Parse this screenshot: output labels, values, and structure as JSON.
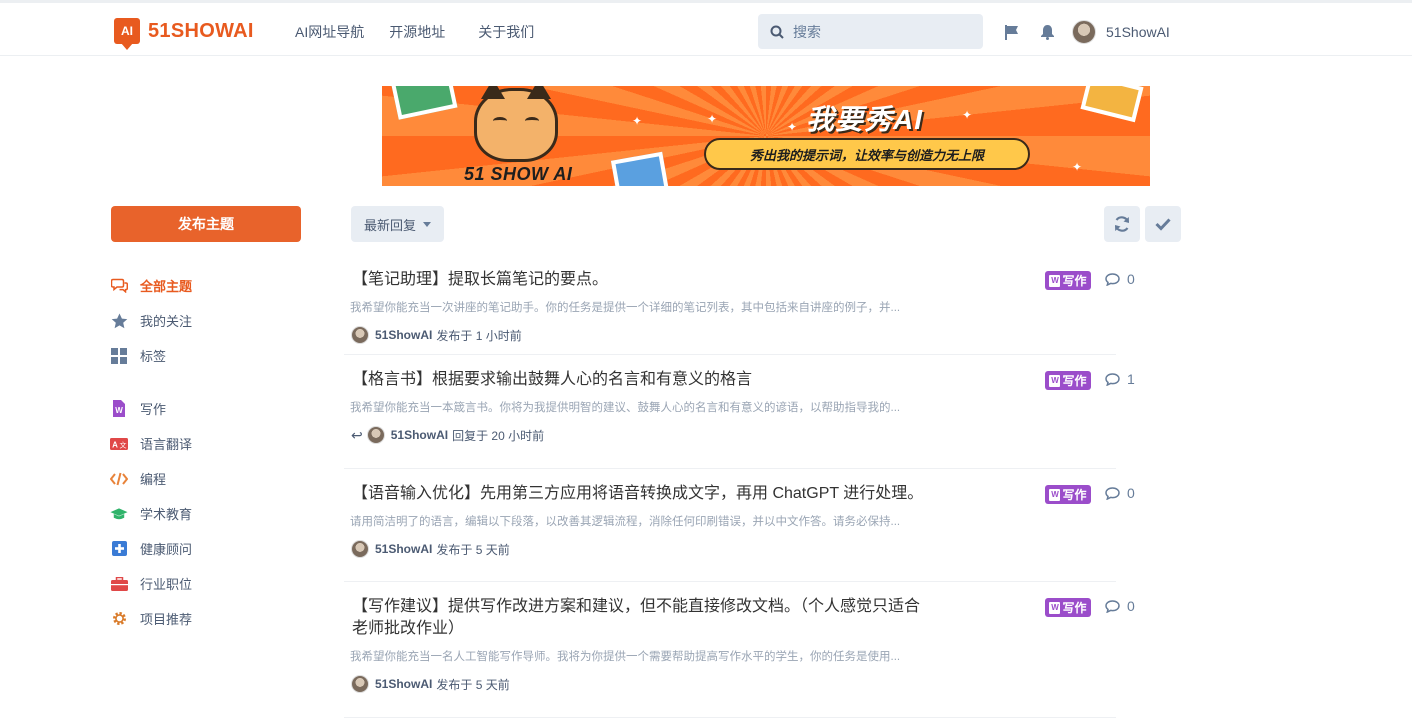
{
  "header": {
    "logo_mark": "AI",
    "logo_text": "51SHOWAI",
    "nav": [
      "AI网址导航",
      "开源地址",
      "关于我们"
    ],
    "search_placeholder": "搜索",
    "username": "51ShowAI"
  },
  "banner": {
    "brand": "51 SHOW AI",
    "headline": "我要秀AI",
    "tagline": "秀出我的提示词，让效率与创造力无上限"
  },
  "sidebar": {
    "new_discussion": "发布主题",
    "items": [
      {
        "label": "全部主题",
        "icon": "comments-icon",
        "active": true
      },
      {
        "label": "我的关注",
        "icon": "star-icon",
        "active": false
      },
      {
        "label": "标签",
        "icon": "grid-icon",
        "active": false
      }
    ],
    "tags": [
      {
        "label": "写作",
        "icon": "word-doc-icon",
        "color": "#9b4dca"
      },
      {
        "label": "语言翻译",
        "icon": "translate-icon",
        "color": "#e04848"
      },
      {
        "label": "编程",
        "icon": "code-icon",
        "color": "#e8833a"
      },
      {
        "label": "学术教育",
        "icon": "graduation-cap-icon",
        "color": "#2fb36a"
      },
      {
        "label": "健康顾问",
        "icon": "medical-plus-icon",
        "color": "#3a7bd5"
      },
      {
        "label": "行业职位",
        "icon": "briefcase-icon",
        "color": "#e04848"
      },
      {
        "label": "项目推荐",
        "icon": "gear-icon",
        "color": "#d97b2a"
      }
    ]
  },
  "toolbar": {
    "sort_label": "最新回复"
  },
  "discussions": [
    {
      "title": "【笔记助理】提取长篇笔记的要点。",
      "excerpt": "我希望你能充当一次讲座的笔记助手。你的任务是提供一个详细的笔记列表，其中包括来自讲座的例子，并...",
      "user": "51ShowAI",
      "action": "发布于 1 小时前",
      "replied": false,
      "tag": "写作",
      "count": "0"
    },
    {
      "title": "【格言书】根据要求输出鼓舞人心的名言和有意义的格言",
      "excerpt": "我希望你能充当一本箴言书。你将为我提供明智的建议、鼓舞人心的名言和有意义的谚语，以帮助指导我的...",
      "user": "51ShowAI",
      "action": "回复于 20 小时前",
      "replied": true,
      "tag": "写作",
      "count": "1"
    },
    {
      "title": "【语音输入优化】先用第三方应用将语音转换成文字，再用 ChatGPT 进行处理。",
      "excerpt": "请用简洁明了的语言，编辑以下段落，以改善其逻辑流程，消除任何印刷错误，并以中文作答。请务必保持...",
      "user": "51ShowAI",
      "action": "发布于 5 天前",
      "replied": false,
      "tag": "写作",
      "count": "0"
    },
    {
      "title": "【写作建议】提供写作改进方案和建议，但不能直接修改文档。（个人感觉只适合老师批改作业）",
      "excerpt": "我希望你能充当一名人工智能写作导师。我将为你提供一个需要帮助提高写作水平的学生，你的任务是使用...",
      "user": "51ShowAI",
      "action": "发布于 5 天前",
      "replied": false,
      "tag": "写作",
      "count": "0"
    }
  ]
}
